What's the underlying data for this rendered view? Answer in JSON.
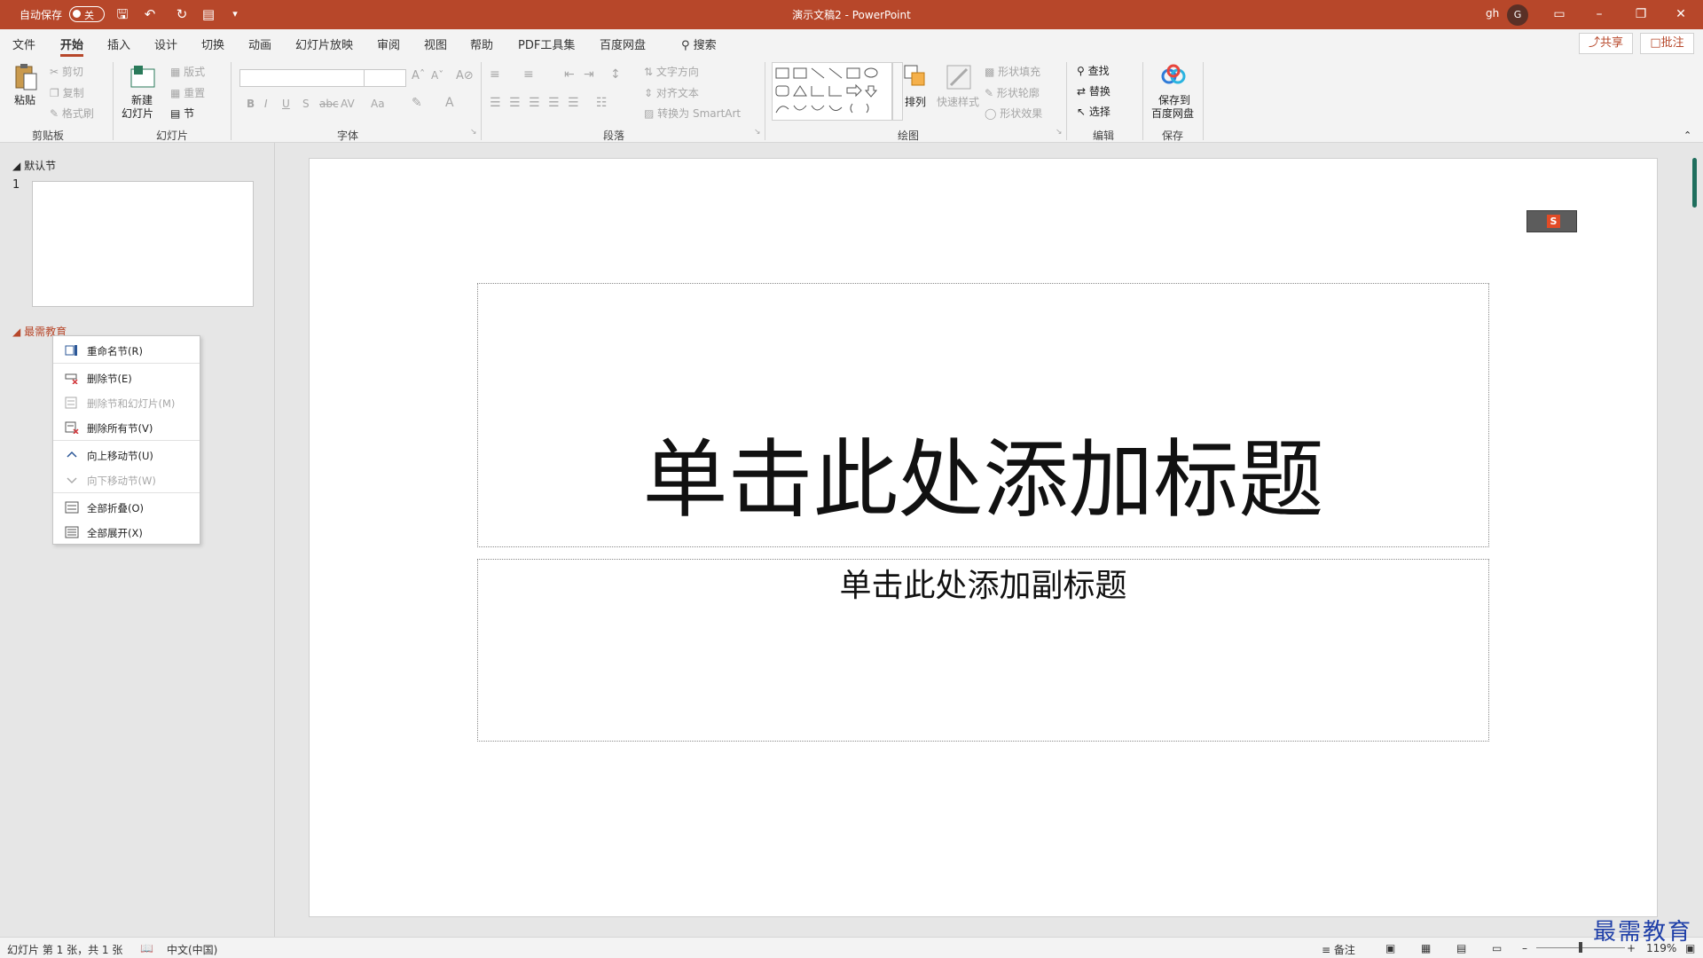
{
  "titlebar": {
    "autosave_label": "自动保存",
    "autosave_state": "关",
    "doc_title": "演示文稿2  -  PowerPoint",
    "user_name": "gh",
    "avatar_initial": "G"
  },
  "menu": {
    "tabs": [
      "文件",
      "开始",
      "插入",
      "设计",
      "切换",
      "动画",
      "幻灯片放映",
      "审阅",
      "视图",
      "帮助",
      "PDF工具集",
      "百度网盘"
    ],
    "active_tab": "开始",
    "search_label": "搜索",
    "share_label": "共享",
    "comment_label": "批注"
  },
  "ribbon": {
    "clipboard": {
      "paste": "粘贴",
      "cut": "剪切",
      "copy": "复制",
      "format_painter": "格式刷",
      "group": "剪贴板"
    },
    "slides": {
      "new_slide": "新建",
      "new_slide_2": "幻灯片",
      "layout": "版式",
      "reset": "重置",
      "section": "节",
      "group": "幻灯片"
    },
    "font": {
      "group": "字体",
      "bold": "B",
      "italic": "I",
      "underline": "U",
      "shadow": "S",
      "strike": "abc",
      "spacing": "AV",
      "case": "Aa"
    },
    "paragraph": {
      "group": "段落",
      "text_direction": "文字方向",
      "align_text": "对齐文本",
      "smartart": "转换为 SmartArt"
    },
    "drawing": {
      "group": "绘图",
      "arrange": "排列",
      "quick_styles": "快速样式",
      "fill": "形状填充",
      "outline": "形状轮廓",
      "effects": "形状效果"
    },
    "editing": {
      "group": "编辑",
      "find": "查找",
      "replace": "替换",
      "select": "选择"
    },
    "save": {
      "group": "保存",
      "save_to": "保存到",
      "baidu": "百度网盘"
    }
  },
  "panel": {
    "section_default": "默认节",
    "slide_number": "1",
    "section_custom": "最需教育"
  },
  "context_menu": {
    "items": [
      {
        "label": "重命名节(R)",
        "disabled": false
      },
      {
        "label": "删除节(E)",
        "disabled": false
      },
      {
        "label": "删除节和幻灯片(M)",
        "disabled": true
      },
      {
        "label": "删除所有节(V)",
        "disabled": false
      },
      {
        "label": "向上移动节(U)",
        "disabled": false
      },
      {
        "label": "向下移动节(W)",
        "disabled": true
      },
      {
        "label": "全部折叠(O)",
        "disabled": false
      },
      {
        "label": "全部展开(X)",
        "disabled": false
      }
    ]
  },
  "slide": {
    "title_placeholder": "单击此处添加标题",
    "subtitle_placeholder": "单击此处添加副标题"
  },
  "statusbar": {
    "slide_info": "幻灯片 第 1 张，共 1 张",
    "language": "中文(中国)",
    "notes": "备注",
    "zoom": "119%"
  },
  "watermark": "最需教育",
  "colors": {
    "accent": "#b7472a",
    "watermark": "#1f3fa8"
  }
}
